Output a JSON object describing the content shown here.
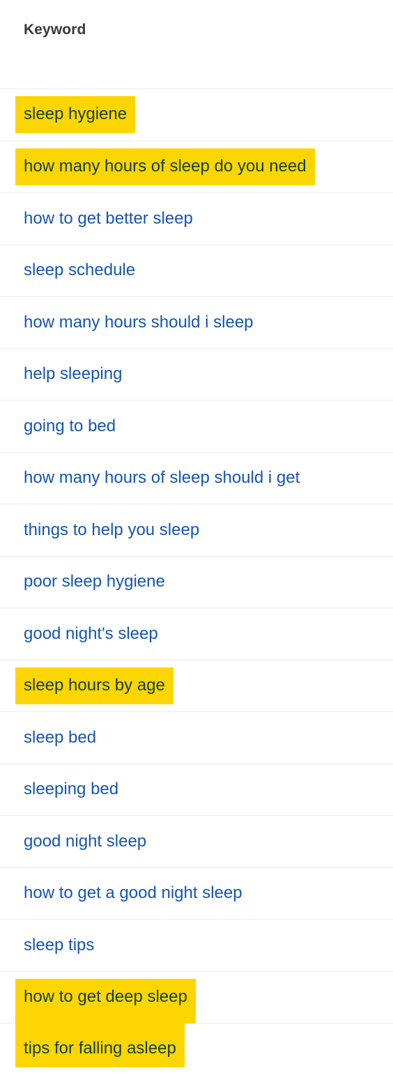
{
  "table": {
    "header": {
      "column_label": "Keyword"
    },
    "colors": {
      "link_text": "#1455b5",
      "highlight_background": "#fdd500",
      "highlighted_text": "#14401f",
      "row_divider": "#eceded",
      "header_text": "#37393b",
      "page_background": "#ffffff"
    },
    "rows": [
      {
        "keyword": "sleep hygiene",
        "highlighted": true
      },
      {
        "keyword": "how many hours of sleep do you need",
        "highlighted": true
      },
      {
        "keyword": "how to get better sleep",
        "highlighted": false
      },
      {
        "keyword": "sleep schedule",
        "highlighted": false
      },
      {
        "keyword": "how many hours should i sleep",
        "highlighted": false
      },
      {
        "keyword": "help sleeping",
        "highlighted": false
      },
      {
        "keyword": "going to bed",
        "highlighted": false
      },
      {
        "keyword": "how many hours of sleep should i get",
        "highlighted": false
      },
      {
        "keyword": "things to help you sleep",
        "highlighted": false
      },
      {
        "keyword": "poor sleep hygiene",
        "highlighted": false
      },
      {
        "keyword": "good night's sleep",
        "highlighted": false
      },
      {
        "keyword": "sleep hours by age",
        "highlighted": true
      },
      {
        "keyword": "sleep bed",
        "highlighted": false
      },
      {
        "keyword": "sleeping bed",
        "highlighted": false
      },
      {
        "keyword": "good night sleep",
        "highlighted": false
      },
      {
        "keyword": "how to get a good night sleep",
        "highlighted": false
      },
      {
        "keyword": "sleep tips",
        "highlighted": false
      },
      {
        "keyword": "how to get deep sleep",
        "highlighted": true
      },
      {
        "keyword": "tips for falling asleep",
        "highlighted": true
      }
    ]
  }
}
